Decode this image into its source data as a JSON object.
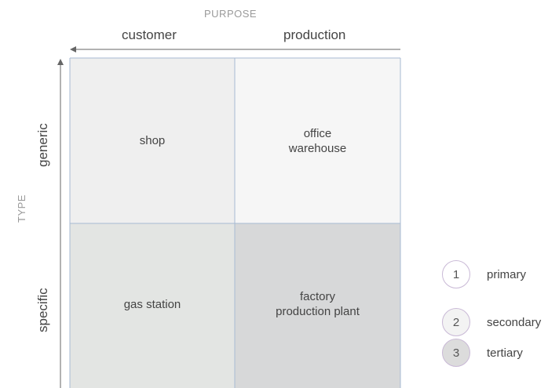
{
  "purpose_axis": {
    "title": "PURPOSE",
    "left_label": "customer",
    "right_label": "production"
  },
  "type_axis": {
    "title": "TYPE",
    "top_label": "generic",
    "bottom_label": "specific"
  },
  "cells": {
    "generic_customer": {
      "text": "shop",
      "color": "#efefef"
    },
    "generic_production": {
      "text": "office\nwarehouse",
      "color": "#f6f6f6"
    },
    "specific_customer": {
      "text": "gas station",
      "color": "#e3e5e3"
    },
    "specific_production": {
      "text": "factory\nproduction plant",
      "color": "#d7d8d9"
    }
  },
  "legend": [
    {
      "number": "1",
      "label": "primary",
      "fill": "#ffffff"
    },
    {
      "number": "2",
      "label": "secondary",
      "fill": "#f3f3f3"
    },
    {
      "number": "3",
      "label": "tertiary",
      "fill": "#dcdcdc"
    }
  ],
  "colors": {
    "grid_line": "#a7bad3",
    "axis_line": "#666666",
    "legend_border": "#c9b9d6"
  }
}
